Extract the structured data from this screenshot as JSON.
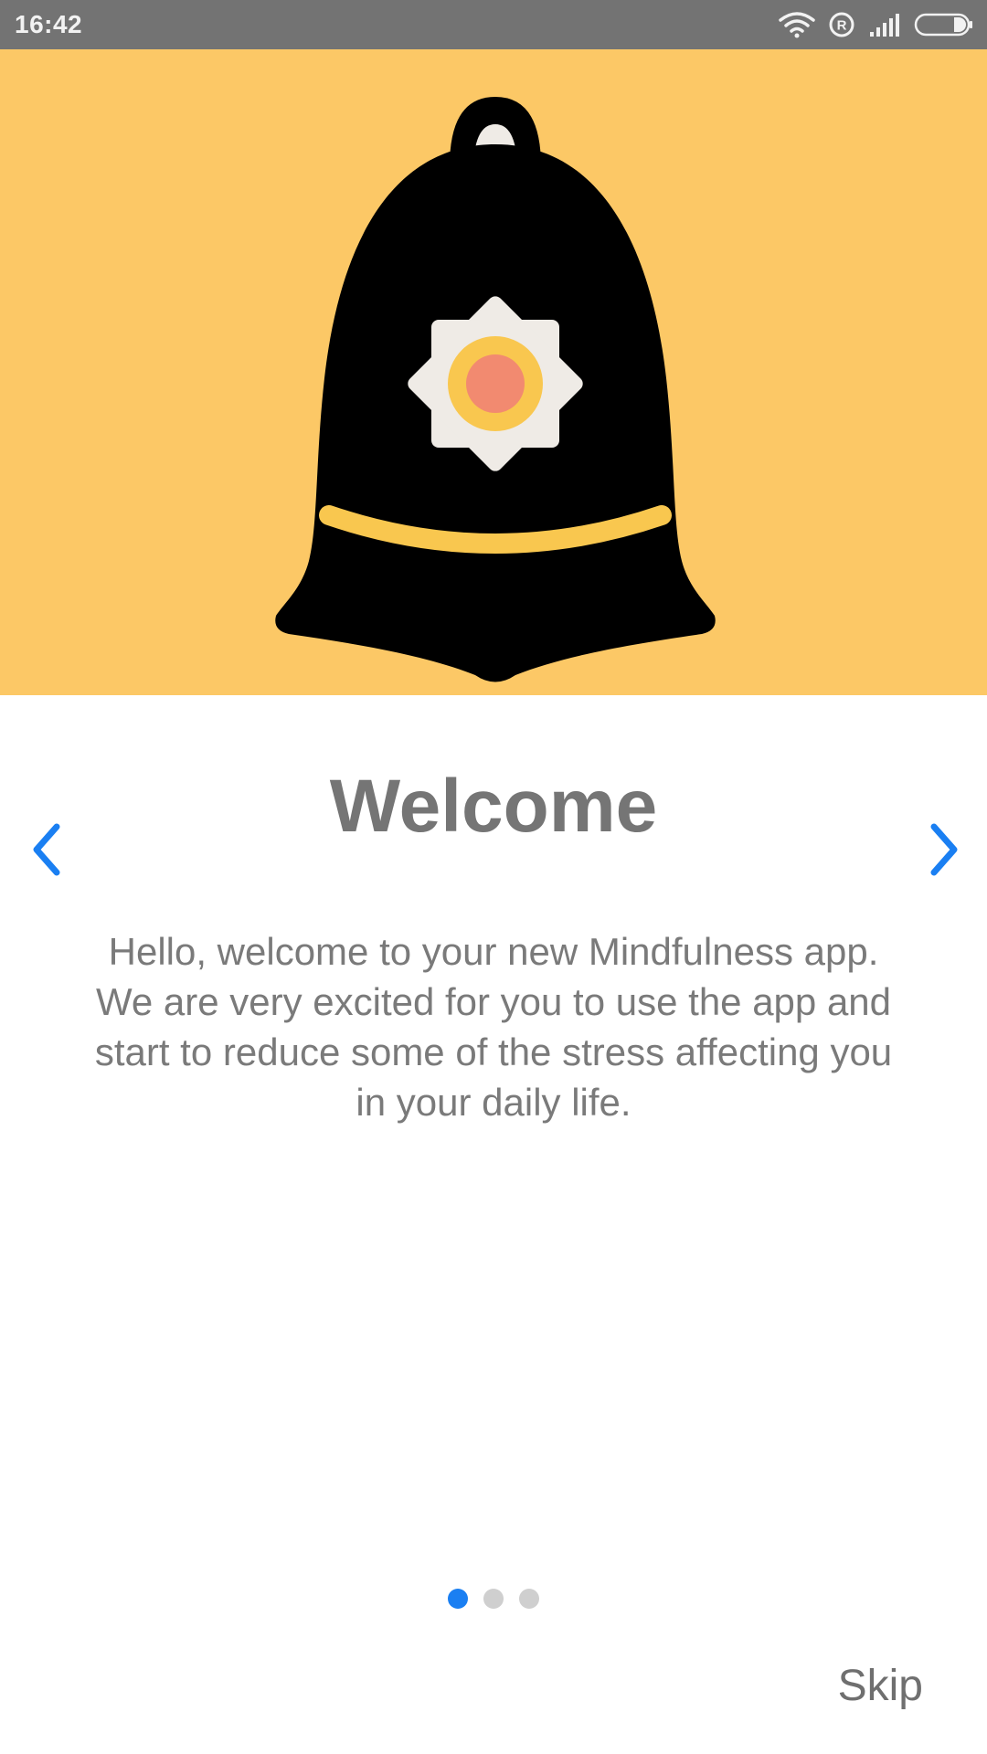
{
  "status_bar": {
    "time": "16:42",
    "icons": [
      "wifi-icon",
      "registered-icon",
      "signal-icon",
      "battery-icon"
    ]
  },
  "hero": {
    "background_color": "#fcc866",
    "illustration": "bell-icon"
  },
  "onboarding": {
    "title": "Welcome",
    "body": "Hello, welcome to your new Mindfulness app. We are very excited for you to use the app and start to reduce some of the stress affecting you in your daily life.",
    "prev_icon": "chevron-left-icon",
    "next_icon": "chevron-right-icon",
    "page_count": 3,
    "current_page": 1,
    "skip_label": "Skip"
  },
  "colors": {
    "accent": "#1a7ff2",
    "text": "#757575",
    "dot_inactive": "#cfcfcf"
  }
}
